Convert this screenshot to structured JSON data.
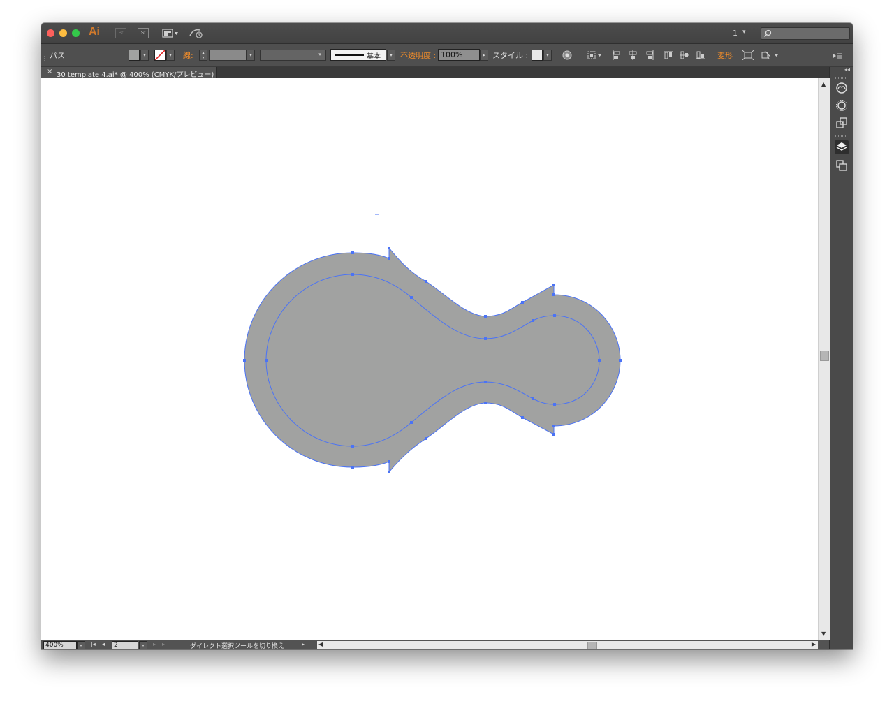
{
  "app": {
    "logo_text": "Ai",
    "bridge_label": "Br",
    "stock_label": "St",
    "page_count": "1"
  },
  "control_bar": {
    "selection_type": "パス",
    "stroke_label": "線",
    "stroke_colon": ":",
    "stroke_profile": "基本",
    "opacity_label": "不透明度",
    "opacity_value": "100%",
    "style_label": "スタイル :",
    "transform_label": "変形",
    "fill_color": "#a1a2a1",
    "accent_color": "#f08c2a"
  },
  "tab": {
    "close": "×",
    "title": "30 template 4.ai* @ 400% (CMYK/プレビュー)"
  },
  "canvas": {
    "shape_fill": "#a1a2a1",
    "path_color": "#4b73f5"
  },
  "status": {
    "zoom": "400%",
    "artboard_number": "2",
    "tool_status": "ダイレクト選択ツールを切り換え"
  },
  "icons": {
    "search": "search-icon",
    "workspace": "workspace-switcher-icon",
    "gpu": "gpu-performance-icon",
    "recolor": "recolor-artwork-icon",
    "align": "align-icons",
    "libraries": "cc-libraries-icon",
    "color_theme": "color-theme-icon",
    "asset_export": "asset-export-icon",
    "layers": "layers-icon",
    "artboards": "artboards-icon"
  }
}
